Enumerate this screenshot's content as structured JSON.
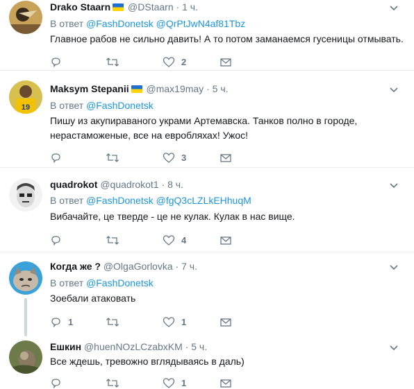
{
  "tweets": [
    {
      "name": "Drako Staarn",
      "handle": "@DStaarn",
      "dot": "·",
      "time": "1 ч.",
      "reply_prefix": "В ответ",
      "reply_links": [
        "@FashDonetsk",
        "@QrPtJwN4af81Tbz"
      ],
      "text": "Главное рабов не сильно давить! А то потом заманаемся гусеницы отмывать.",
      "likes": "2"
    },
    {
      "name": "Maksym Stepanii",
      "handle": "@max19may",
      "dot": "·",
      "time": "5 ч.",
      "reply_prefix": "В ответ",
      "reply_links": [
        "@FashDonetsk"
      ],
      "text_lines": [
        "Пишу из акупираваного украми Артемавска. Танков полно в городе,",
        "нерастаможеные, все на евробляхах! Ужос!"
      ],
      "likes": "3"
    },
    {
      "name": "quadrokot",
      "handle": "@quadrokot1",
      "dot": "·",
      "time": "8 ч.",
      "reply_prefix": "В ответ",
      "reply_links": [
        "@FashDonetsk",
        "@fgQ3cLZLkEHhuqM"
      ],
      "text": "Вибачайте, це тверде - це не кулак. Кулак в нас вище.",
      "likes": "4"
    },
    {
      "name": "Когда же ?",
      "handle": "@OlgaGorlovka",
      "dot": "·",
      "time": "7 ч.",
      "reply_prefix": "В ответ",
      "reply_links": [
        "@FashDonetsk"
      ],
      "text": "Зоебали атаковать",
      "replies": "1",
      "likes": "1"
    },
    {
      "name": "Ешкин",
      "handle": "@huenNOzLCzabxKM",
      "dot": "·",
      "time": "5 ч.",
      "text": "Все ждешь, тревожно вглядываясь в даль)",
      "likes": "1"
    }
  ]
}
